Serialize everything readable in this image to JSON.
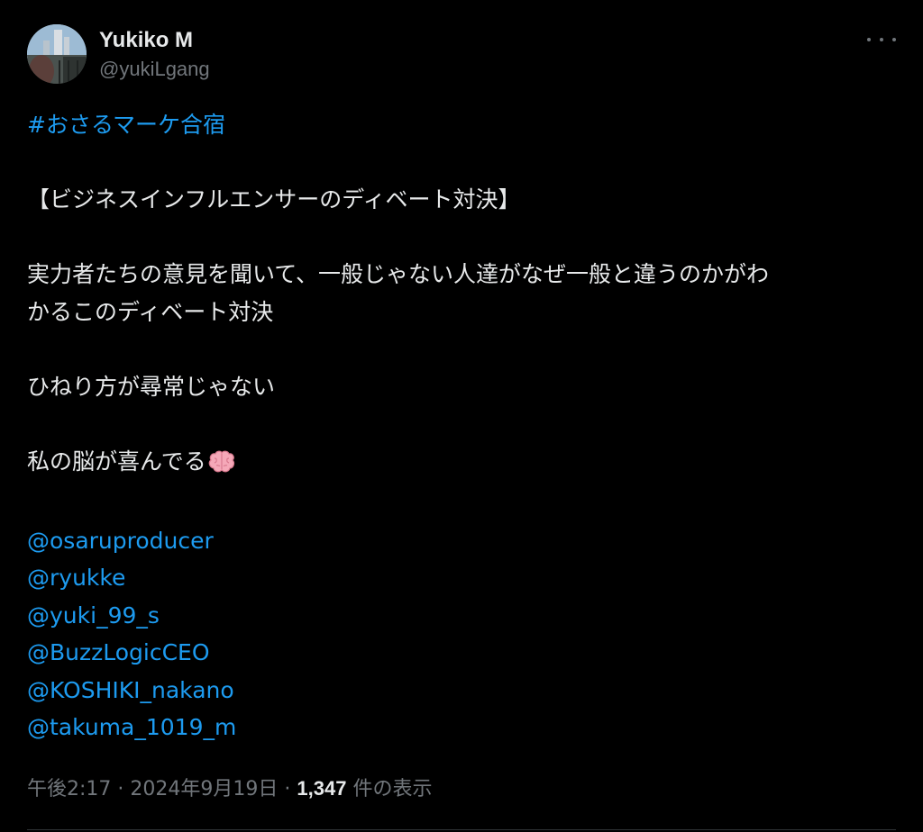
{
  "author": {
    "display_name": "Yukiko M",
    "handle": "@yukiLgang",
    "avatar_icon": "profile-photo-avatar"
  },
  "more_icon": "more-dots-icon",
  "tweet": {
    "hashtag": "#おさるマーケ合宿",
    "line_title": "【ビジネスインフルエンサーのディベート対決】",
    "line_body_1": "実力者たちの意見を聞いて、一般じゃない人達がなぜ一般と違うのかがわ",
    "line_body_2": "かるこのディベート対決",
    "line_twist": "ひねり方が尋常じゃない",
    "line_brain": "私の脳が喜んでる",
    "brain_icon": "brain-emoji",
    "mentions": [
      "@osaruproducer",
      "@ryukke",
      "@yuki_99_s",
      "@BuzzLogicCEO",
      "@KOSHIKI_nakano",
      "@takuma_1019_m"
    ]
  },
  "meta": {
    "time": "午後2:17",
    "separator": "·",
    "date": "2024年9月19日",
    "views_count": "1,347",
    "views_label": "件の表示"
  },
  "colors": {
    "background": "#000000",
    "text": "#e7e9ea",
    "muted": "#71767b",
    "link": "#1d9bf0"
  }
}
